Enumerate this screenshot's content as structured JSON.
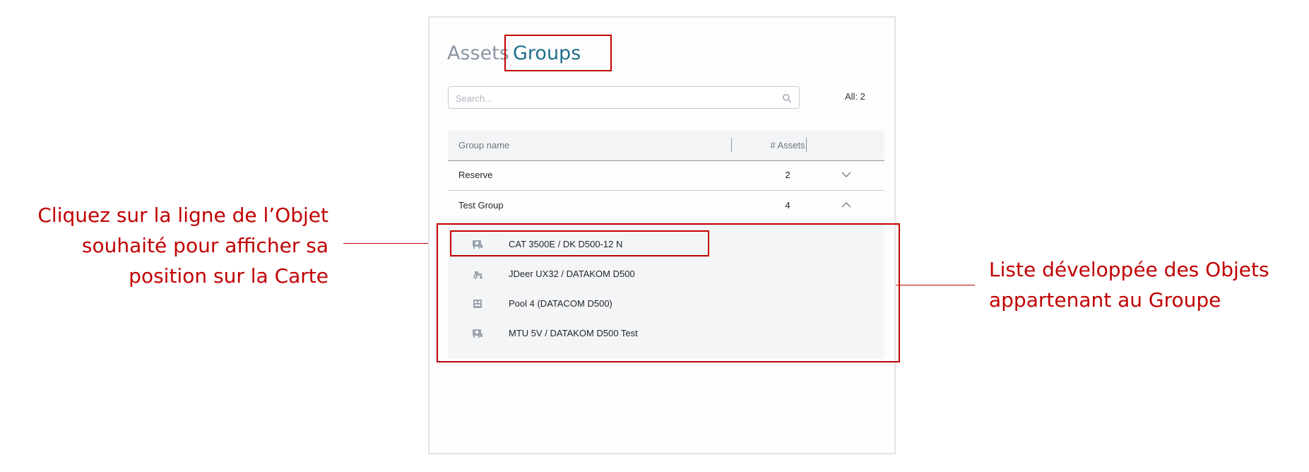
{
  "annotations": {
    "left": [
      "Cliquez sur la ligne de l’Objet",
      "souhaité pour afficher sa",
      "position sur la Carte"
    ],
    "right": [
      "Liste développée des Objets",
      "appartenant au Groupe"
    ],
    "highlight_color": "#c00000"
  },
  "tabs": {
    "assets": "Assets",
    "groups": "Groups",
    "active": "groups"
  },
  "search": {
    "placeholder": "Search...",
    "value": ""
  },
  "count_label": "All: 2",
  "table": {
    "headers": {
      "name": "Group name",
      "assets": "# Assets"
    },
    "groups": [
      {
        "name": "Reserve",
        "count": "2",
        "expanded": false,
        "chevron": "chevron-down-icon"
      },
      {
        "name": "Test Group",
        "count": "4",
        "expanded": true,
        "chevron": "chevron-up-icon"
      }
    ]
  },
  "expanded_assets": [
    {
      "name": "CAT 3500E / DK D500-12 N",
      "icon": "generator-icon",
      "highlighted": true
    },
    {
      "name": "JDeer UX32 / DATAKOM D500",
      "icon": "tractor-icon",
      "highlighted": false
    },
    {
      "name": "Pool 4 (DATACOM D500)",
      "icon": "pool-generator-icon",
      "highlighted": false
    },
    {
      "name": "MTU 5V / DATAKOM D500 Test",
      "icon": "generator-icon",
      "highlighted": false
    }
  ],
  "colors": {
    "accent": "#1f6f8b",
    "inactive_tab": "#8a96a4",
    "annotation": "#c00000"
  }
}
